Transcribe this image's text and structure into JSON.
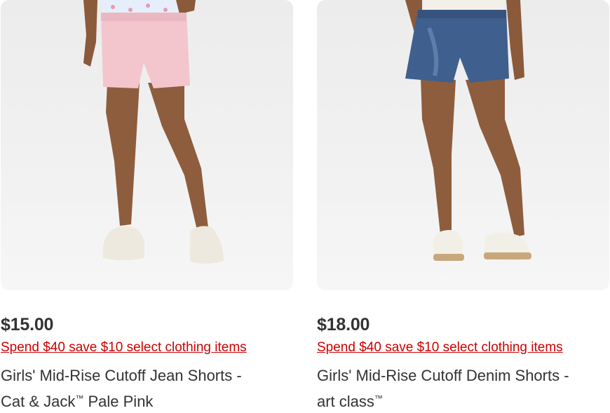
{
  "products": [
    {
      "price": "$15.00",
      "promo": "Spend $40 save $10 select clothing items",
      "title_line1": "Girls' Mid-Rise Cutoff Jean Shorts -",
      "title_line2_a": "Cat & Jack",
      "title_line2_tm": "™",
      "title_line2_b": " Pale Pink",
      "image_alt": "Pale pink cutoff jean shorts worn with white sneakers"
    },
    {
      "price": "$18.00",
      "promo": "Spend $40 save $10 select clothing items",
      "title_line1": "Girls' Mid-Rise Cutoff Denim Shorts -",
      "title_line2_a": "art class",
      "title_line2_tm": "™",
      "title_line2_b": "",
      "image_alt": "Blue cutoff denim shorts worn with white sandals"
    }
  ],
  "colors": {
    "promo_red": "#cc0000",
    "text": "#333333",
    "image_bg": "#f0f0f0"
  }
}
